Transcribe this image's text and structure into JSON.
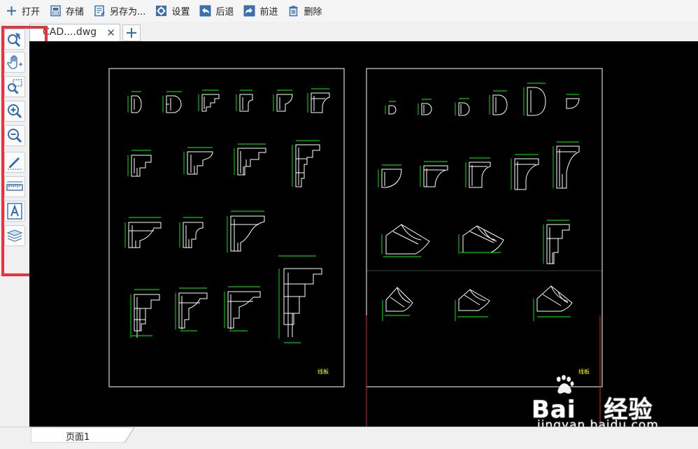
{
  "toolbar": {
    "open": "打开",
    "save": "存储",
    "save_as": "另存为...",
    "settings": "设置",
    "back": "后退",
    "forward": "前进",
    "delete": "删除"
  },
  "tabs": {
    "active_label": "CAD....dwg",
    "close_glyph": "✕"
  },
  "left_tools": [
    {
      "icon": "zoom-extents-icon"
    },
    {
      "icon": "pan-hand-icon"
    },
    {
      "icon": "zoom-window-icon"
    },
    {
      "icon": "zoom-in-icon"
    },
    {
      "icon": "zoom-out-icon"
    },
    {
      "icon": "pencil-markup-icon"
    },
    {
      "icon": "measure-ruler-icon"
    },
    {
      "icon": "text-annotation-icon"
    },
    {
      "icon": "layers-icon"
    }
  ],
  "drawing": {
    "sheet1_label": "线板",
    "sheet2_label": "线板"
  },
  "footer": {
    "page_tab": "页面1"
  },
  "watermark": {
    "brand": "Bai",
    "brand2": "经验",
    "url": "jingyan.baidu.com"
  },
  "colors": {
    "highlight": "#e8323c",
    "cad_lines": "#ffffff",
    "dimension": "#00ff00",
    "accent_blue": "#2f6db5"
  }
}
